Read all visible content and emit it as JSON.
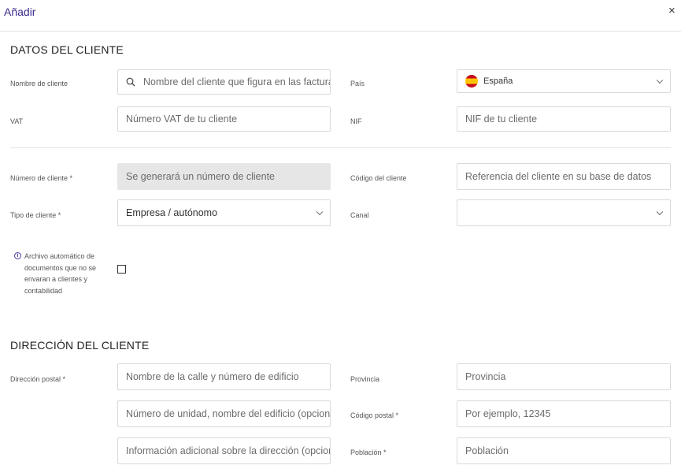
{
  "header": {
    "title": "Añadir",
    "close_symbol": "×"
  },
  "client_data": {
    "section_title": "DATOS DEL CLIENTE",
    "client_name": {
      "label": "Nombre de cliente",
      "placeholder": "Nombre del cliente que figura en las facturas"
    },
    "country": {
      "label": "País",
      "value": "España"
    },
    "vat": {
      "label": "VAT",
      "placeholder": "Número VAT de tu cliente"
    },
    "nif": {
      "label": "NIF",
      "placeholder": "NIF de tu cliente"
    },
    "client_number": {
      "label": "Número de cliente *",
      "value": "Se generará un número de cliente"
    },
    "client_code": {
      "label": "Código del cliente",
      "placeholder": "Referencia del cliente en su base de datos"
    },
    "client_type": {
      "label": "Tipo de cliente *",
      "value": "Empresa / autónomo"
    },
    "channel": {
      "label": "Canal",
      "value": ""
    },
    "auto_archive": {
      "label_lines": [
        "Archivo automático de",
        "documentos que no se",
        "envaran a clientes y",
        "contabilidad"
      ],
      "checked": false
    }
  },
  "address": {
    "section_title": "DIRECCIÓN DEL CLIENTE",
    "postal_label": "Dirección postal *",
    "street_placeholder": "Nombre de la calle y número de edificio",
    "unit_placeholder": "Número de unidad, nombre del edificio (opcional)",
    "extra_placeholder": "Información adicional sobre la dirección (opcional)",
    "province": {
      "label": "Provincia",
      "placeholder": "Provincia"
    },
    "postal_code": {
      "label": "Código postal *",
      "placeholder": "Por ejemplo, 12345"
    },
    "city": {
      "label": "Población *",
      "placeholder": "Población"
    }
  },
  "colors": {
    "title": "#3b2a8c",
    "disabled_bg": "#e6e6e6",
    "border": "#d9d9d9"
  }
}
